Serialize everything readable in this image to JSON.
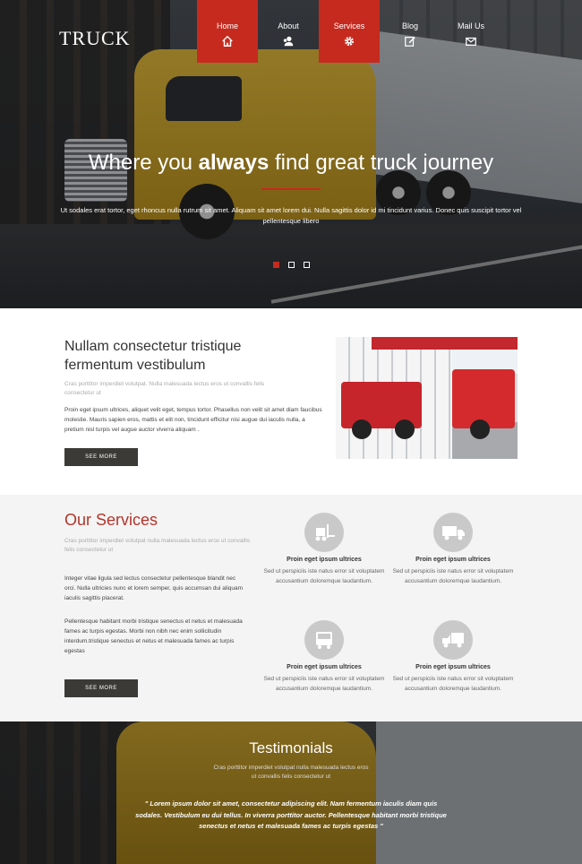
{
  "brand": {
    "logo": "TRUCK"
  },
  "nav": [
    {
      "label": "Home",
      "icon": "home-icon",
      "active": true
    },
    {
      "label": "About",
      "icon": "users-icon",
      "active": false
    },
    {
      "label": "Services",
      "icon": "gear-icon",
      "active": true
    },
    {
      "label": "Blog",
      "icon": "edit-icon",
      "active": false
    },
    {
      "label": "Mail Us",
      "icon": "mail-icon",
      "active": false
    }
  ],
  "hero": {
    "title_pre": "Where you ",
    "title_bold": "always",
    "title_post": " find great truck journey",
    "text": "Ut sodales erat tortor, eget rhoncus nulla rutrum sit amet. Aliquam sit amet lorem dui. Nulla sagittis dolor id mi tincidunt varius. Donec quis suscipit tortor vel pellentesque libero",
    "slides": 3,
    "active_slide": 1
  },
  "about": {
    "title": "Nullam consectetur tristique fermentum vestibulum",
    "sub": "Cras porttitor imperdiet volutpat. Nulla malesuada lectus eros ut convallis felis consectetur ut",
    "body": "Proin eget ipsum ultrices, aliquet velit eget, tempus tortor. Phasellus non velit sit amet diam faucibus molestie. Mauris sapien eros, mattis et elit non, tincidunt efficitur nisi augue dui iaculis nulla, a pretium nisl turpis vel augue auctor viverra aliquam .",
    "button": "SEE MORE"
  },
  "services": {
    "title": "Our Services",
    "sub": "Cras porttitor imperdiet volutpat nulla malesuada lectus eros ut convallis felis consectetur ut",
    "p1": "Integer vitae ligula sed lectus consectetur pellentesque blandit nec orci. Nulla ultricies nunc et lorem semper, quis accumsan dui aliquam iaculis sagittis placerat.",
    "p2": "Pellentesque habitant morbi tristique senectus et netus et malesuada fames ac turpis egestas. Morbi non nibh nec enim sollicitudin interdum.tristique senectus et netus et malesuada fames ac turpis egestas",
    "button": "SEE MORE",
    "items": [
      {
        "icon": "forklift-icon",
        "title": "Proin eget ipsum ultrices",
        "desc": "Sed ut perspiciis iste natus error sit voluptatem accusantium doloremque laudantium."
      },
      {
        "icon": "truck-icon",
        "title": "Proin eget ipsum ultrices",
        "desc": "Sed ut perspiciis iste natus error sit voluptatem accusantium doloremque laudantium."
      },
      {
        "icon": "bus-icon",
        "title": "Proin eget ipsum ultrices",
        "desc": "Sed ut perspiciis iste natus error sit voluptatem accusantium doloremque laudantium."
      },
      {
        "icon": "delivery-truck-icon",
        "title": "Proin eget ipsum ultrices",
        "desc": "Sed ut perspiciis iste natus error sit voluptatem accusantium doloremque laudantium."
      }
    ]
  },
  "testimonials": {
    "title": "Testimonials",
    "sub": "Cras porttitor imperdiet volutpat nulla malesuada lectus eros ut convallis felis consectetur ut",
    "quote": "\" Lorem ipsum dolor sit amet, consectetur adipiscing elit. Nam fermentum iaculis diam quis sodales. Vestibulum eu dui tellus. In viverra porttitor auctor. Pellentesque habitant morbi tristique senectus et netus et malesuada fames ac turpis egestas \""
  },
  "colors": {
    "accent": "#c62a1f",
    "button": "#3b3a37",
    "services_bg": "#f4f4f4"
  }
}
